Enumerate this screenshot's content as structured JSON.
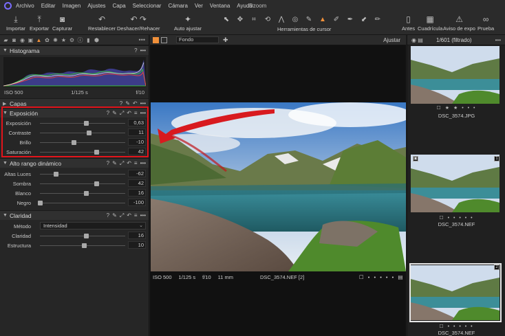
{
  "menu": {
    "items": [
      "Archivo",
      "Editar",
      "Imagen",
      "Ajustes",
      "Capa",
      "Seleccionar",
      "Cámara",
      "Ver",
      "Ventana",
      "Ayuda"
    ],
    "window_title": "Dzoom"
  },
  "toolbar": {
    "import": "Importar",
    "export": "Exportar",
    "capture": "Capturar",
    "reset": "Restablecer",
    "undo_redo": "Deshacer/Rehacer",
    "auto_adjust": "Auto ajustar",
    "cursor_tools": "Herramientas de cursor",
    "before": "Antes",
    "grid": "Cuadrícula",
    "exposure_warning": "Aviso de expo",
    "proof": "Prueba"
  },
  "histogram": {
    "title": "Histograma",
    "iso": "ISO 500",
    "shutter": "1/125 s",
    "aperture": "f/10"
  },
  "layers": {
    "title": "Capas"
  },
  "exposure": {
    "title": "Exposición",
    "sliders": [
      {
        "label": "Exposición",
        "value": "0,63",
        "position": 0.56
      },
      {
        "label": "Contraste",
        "value": "11",
        "position": 0.59
      },
      {
        "label": "Brillo",
        "value": "-10",
        "position": 0.41
      },
      {
        "label": "Saturación",
        "value": "42",
        "position": 0.68
      }
    ]
  },
  "hdr": {
    "title": "Alto rango dinámico",
    "sliders": [
      {
        "label": "Altas Luces",
        "value": "-62",
        "position": 0.19
      },
      {
        "label": "Sombra",
        "value": "42",
        "position": 0.68
      },
      {
        "label": "Blanco",
        "value": "16",
        "position": 0.56
      },
      {
        "label": "Negro",
        "value": "-100",
        "position": 0.0
      }
    ]
  },
  "clarity": {
    "title": "Claridad",
    "method_label": "Método",
    "method_value": "Intensidad",
    "sliders": [
      {
        "label": "Claridad",
        "value": "16",
        "position": 0.56
      },
      {
        "label": "Estructura",
        "value": "10",
        "position": 0.53
      }
    ]
  },
  "viewer": {
    "background_select": "Fondo",
    "fit": "Ajustar",
    "iso": "ISO 500",
    "shutter": "1/125 s",
    "aperture": "f/10",
    "focal": "11 mm",
    "filename": "DSC_3574.NEF [2]"
  },
  "browser": {
    "count": "1/601 (filtrado)",
    "thumbs": [
      {
        "caption": "DSC_3574.JPG",
        "rating": 2
      },
      {
        "caption": "DSC_3574.NEF",
        "rating": 0,
        "badge": "1"
      },
      {
        "caption": "DSC_3574.NEF",
        "rating": 0,
        "badge": "2"
      }
    ]
  },
  "colors": {
    "accent": "#f0903a",
    "highlight_box": "#e3141b"
  }
}
